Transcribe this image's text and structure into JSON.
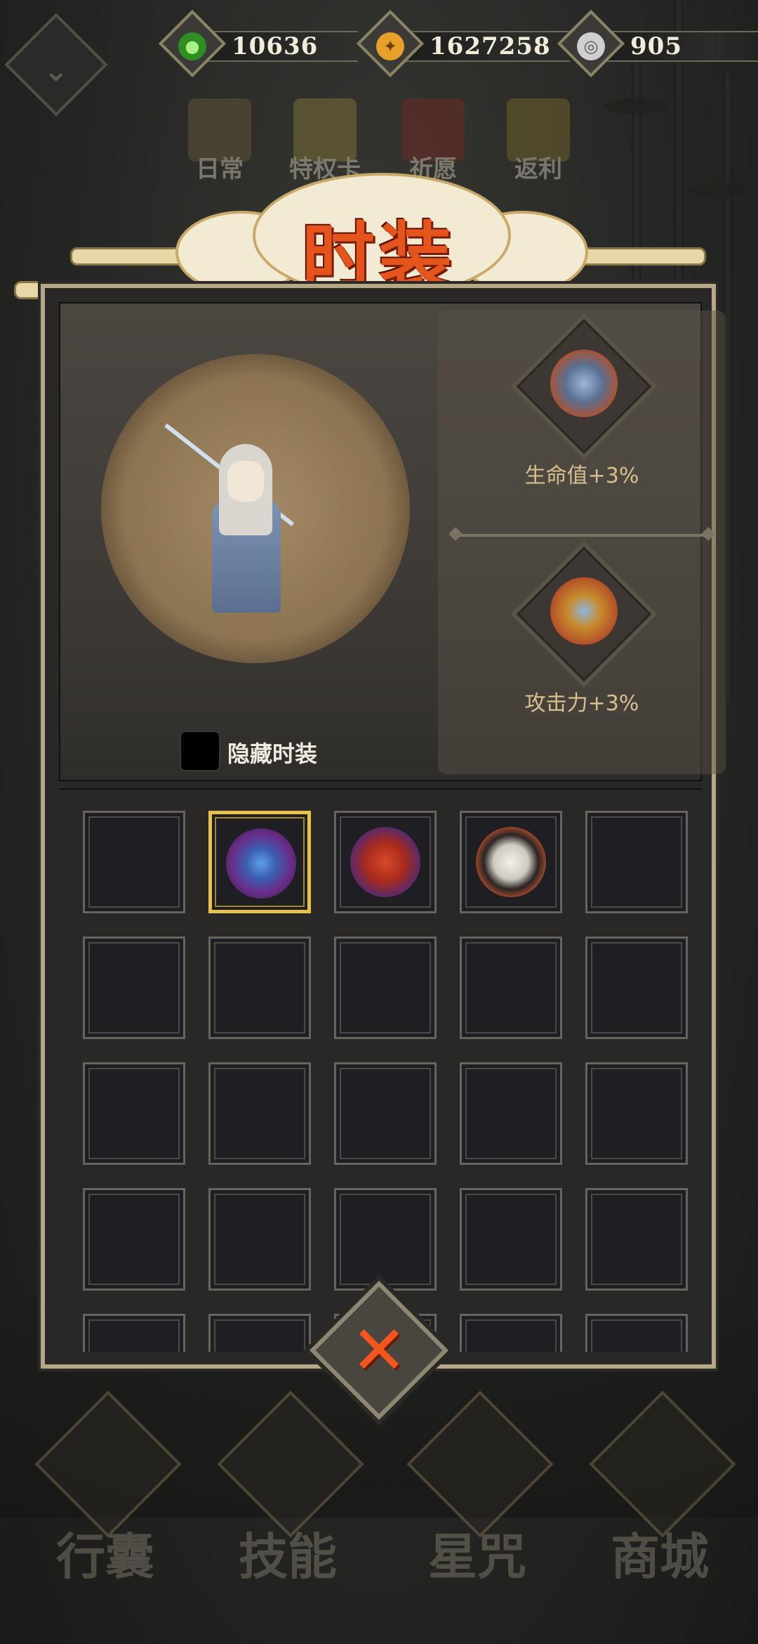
{
  "currencies": [
    {
      "icon": "jade-icon",
      "value": "10636",
      "color": "#3fa32a"
    },
    {
      "icon": "gold-coin-icon",
      "value": "1627258",
      "color": "#e7a12b"
    },
    {
      "icon": "silver-coin-icon",
      "value": "905",
      "color": "#c9c9c9"
    }
  ],
  "top_menu": [
    {
      "label": "日常",
      "icon": "scroll-icon"
    },
    {
      "label": "特权卡",
      "icon": "card-icon"
    },
    {
      "label": "祈愿",
      "icon": "shrine-icon"
    },
    {
      "label": "返利",
      "icon": "treasure-chest-icon"
    }
  ],
  "title": "时装",
  "preview": {
    "hide_label": "隐藏时装",
    "hide_checked": false
  },
  "bonuses": [
    {
      "icon": "robe-icon",
      "text": "生命值+3%"
    },
    {
      "icon": "sword-icon",
      "text": "攻击力+3%"
    }
  ],
  "costumes": [
    {
      "icon": "",
      "selected": false
    },
    {
      "icon": "fan-staff-icon",
      "selected": true
    },
    {
      "icon": "red-armor-icon",
      "selected": false
    },
    {
      "icon": "white-robe-icon",
      "selected": false
    },
    {
      "icon": "",
      "selected": false
    }
  ],
  "bottom_nav": [
    {
      "label": "行囊",
      "icon": "bag-icon"
    },
    {
      "label": "技能",
      "icon": "dragon-blade-icon"
    },
    {
      "label": "星咒",
      "icon": "star-scroll-icon"
    },
    {
      "label": "商城",
      "icon": "shop-icon"
    }
  ],
  "close_icon": "close-icon"
}
